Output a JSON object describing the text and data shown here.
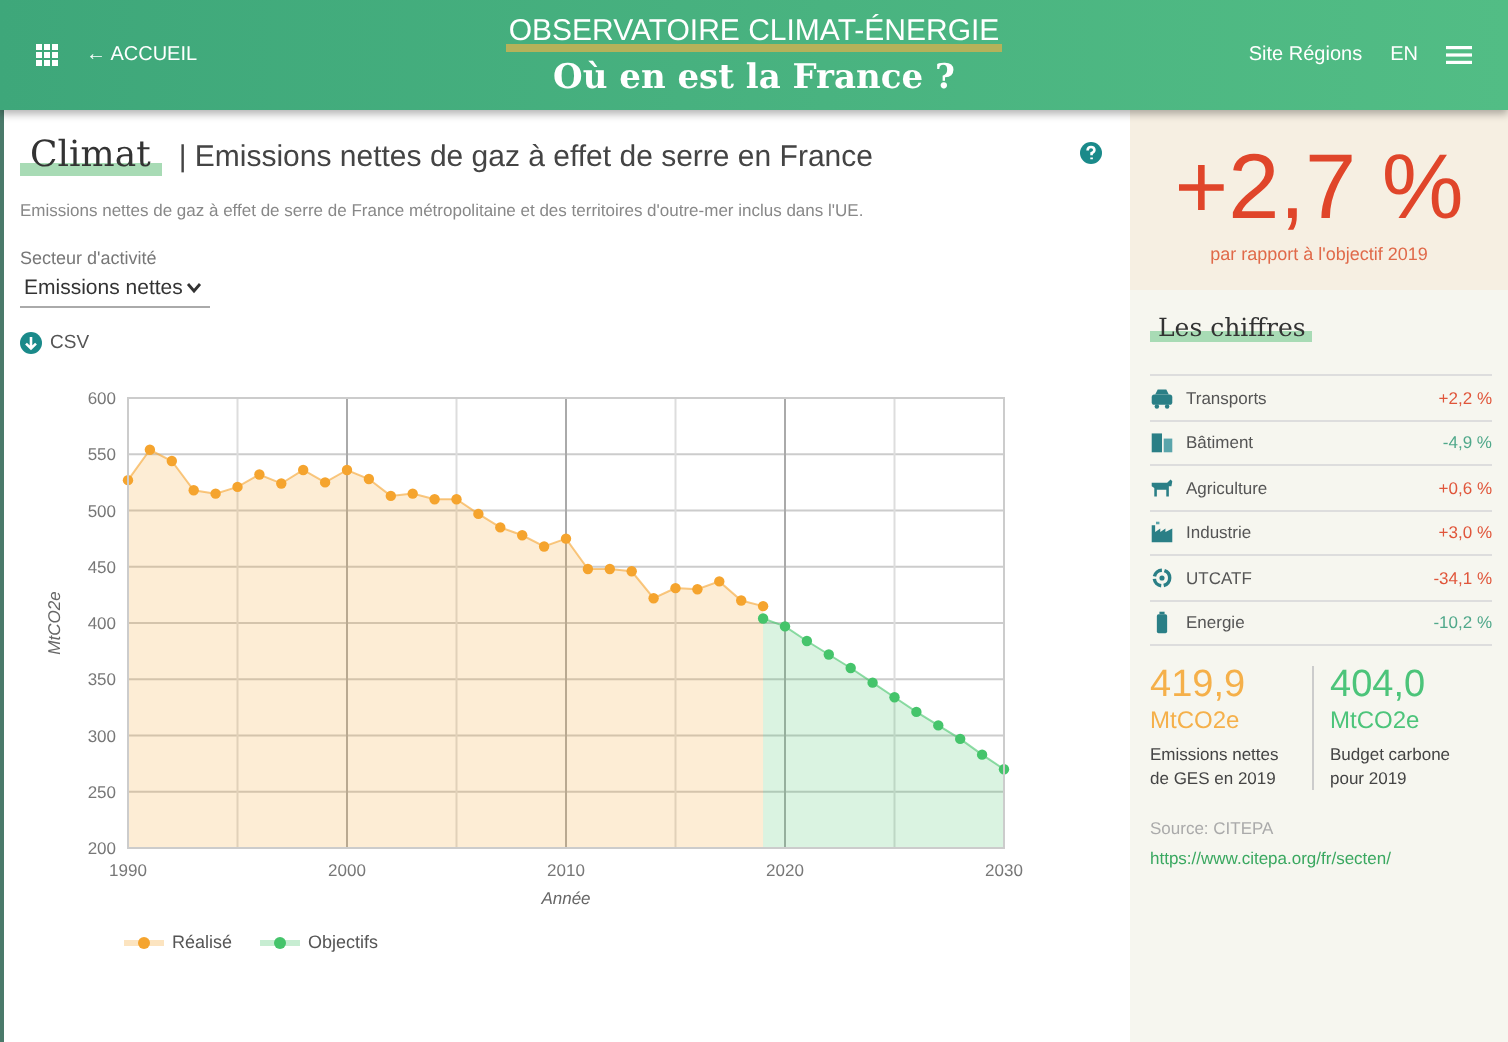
{
  "header": {
    "back_link": "← ACCUEIL",
    "title": "OBSERVATOIRE CLIMAT-ÉNERGIE",
    "subtitle": "Où en est la France ?",
    "links": [
      "Site Régions",
      "EN"
    ]
  },
  "main": {
    "title": "Climat",
    "heading": "| Emissions nettes de gaz à effet de serre en France",
    "description": "Emissions nettes de gaz à effet de serre de France métropolitaine et des territoires d'outre-mer inclus dans l'UE.",
    "sector_label": "Secteur d'activité",
    "sector_value": "Emissions nettes",
    "csv": "CSV",
    "chart_data": {
      "type": "area",
      "xlabel": "Année",
      "ylabel": "MtCO2e",
      "x": [
        1990,
        1991,
        1992,
        1993,
        1994,
        1995,
        1996,
        1997,
        1998,
        1999,
        2000,
        2001,
        2002,
        2003,
        2004,
        2005,
        2006,
        2007,
        2008,
        2009,
        2010,
        2011,
        2012,
        2013,
        2014,
        2015,
        2016,
        2017,
        2018,
        2019,
        2020,
        2021,
        2022,
        2023,
        2024,
        2025,
        2026,
        2027,
        2028,
        2029,
        2030
      ],
      "series": [
        {
          "name": "Réalisé",
          "color": "#f5a42e",
          "values": [
            527,
            554,
            544,
            518,
            515,
            521,
            532,
            524,
            536,
            525,
            536,
            528,
            513,
            515,
            510,
            510,
            497,
            485,
            478,
            468,
            475,
            448,
            448,
            446,
            422,
            431,
            430,
            437,
            420,
            415,
            null,
            null,
            null,
            null,
            null,
            null,
            null,
            null,
            null,
            null,
            null
          ]
        },
        {
          "name": "Objectifs",
          "color": "#45c46b",
          "values": [
            null,
            null,
            null,
            null,
            null,
            null,
            null,
            null,
            null,
            null,
            null,
            null,
            null,
            null,
            null,
            null,
            null,
            null,
            null,
            null,
            null,
            null,
            null,
            null,
            null,
            null,
            null,
            null,
            null,
            404,
            397,
            384,
            372,
            360,
            347,
            334,
            321,
            309,
            297,
            283,
            270
          ]
        }
      ],
      "grid": true,
      "xlim": [
        1990,
        2030
      ],
      "ylim": [
        200,
        600
      ],
      "xticks": [
        1990,
        2000,
        2010,
        2020,
        2030
      ],
      "yticks": [
        200,
        250,
        300,
        350,
        400,
        450,
        500,
        550,
        600
      ]
    }
  },
  "summary": {
    "value": "+2,7 %",
    "caption": "par rapport à l'objectif 2019",
    "section_title": "Les chiffres",
    "sectors": [
      {
        "label": "Transports",
        "value": "+2,2 %",
        "color": "#e0553a"
      },
      {
        "label": "Bâtiment",
        "value": "-4,9 %",
        "color": "#4fa88a"
      },
      {
        "label": "Agriculture",
        "value": "+0,6 %",
        "color": "#e0553a"
      },
      {
        "label": "Industrie",
        "value": "+3,0 %",
        "color": "#e0553a"
      },
      {
        "label": "UTCATF",
        "value": "-34,1 %",
        "color": "#e0553a"
      },
      {
        "label": "Energie",
        "value": "-10,2 %",
        "color": "#4fa88a"
      }
    ],
    "stats": [
      {
        "value": "419,9",
        "unit": "MtCO2e",
        "label": "Emissions nettes de GES en 2019",
        "color": "#f5b04a"
      },
      {
        "value": "404,0",
        "unit": "MtCO2e",
        "label": "Budget carbone pour 2019",
        "color": "#4cc47a"
      }
    ],
    "source": "Source: CITEPA",
    "link": "https://www.citepa.org/fr/secten/"
  }
}
